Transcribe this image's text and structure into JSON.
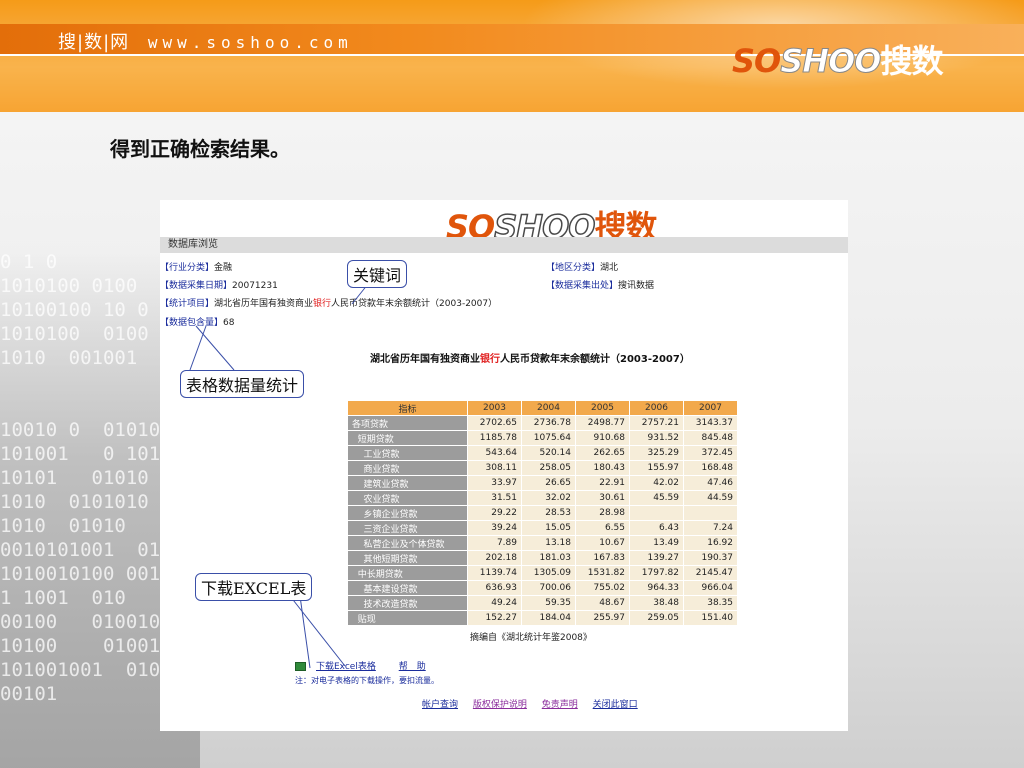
{
  "banner": {
    "site_name": "搜|数|网",
    "site_url": "www.soshoo.com",
    "logo": {
      "so": "SO",
      "shoo": "SHOO",
      "cn": "搜数"
    }
  },
  "heading": "得到正确检索结果。",
  "background_binary": "0 1 0\n1010100 0100\n10100100 10 0\n1010100  0100\n1010  001001\n\n\n10010 0  01010\n101001   0 1010\n10101   01010\n1010  0101010\n1010  01010   0\n0010101001  01\n1010010100 001\n1 1001  010   10\n00100   010010\n10100    01001\n101001001  0100100   010\n00101",
  "panel": {
    "logo": {
      "so": "SO",
      "shoo": "SHOO",
      "cn": "搜数"
    },
    "db_bar": "数据库浏览",
    "industry_label": "【行业分类】",
    "industry_value": "金融",
    "date_label": "【数据采集日期】",
    "date_value": "20071231",
    "stat_label": "【统计项目】",
    "stat_prefix": "湖北省历年国有独资商业",
    "stat_keyword": "银行",
    "stat_suffix": "人民币贷款年末余额统计（2003-2007）",
    "count_label": "【数据包含量】",
    "count_value": "68",
    "region_label": "【地区分类】",
    "region_value": "湖北",
    "source_label": "【数据采集出处】",
    "source_value": "搜讯数据",
    "table_title_prefix": "湖北省历年国有独资商业",
    "table_title_keyword": "银行",
    "table_title_suffix": "人民币贷款年末余额统计（2003-2007）",
    "table": {
      "headers": [
        "指标",
        "2003",
        "2004",
        "2005",
        "2006",
        "2007"
      ],
      "rows": [
        [
          "各项贷款",
          "2702.65",
          "2736.78",
          "2498.77",
          "2757.21",
          "3143.37"
        ],
        [
          "  短期贷款",
          "1185.78",
          "1075.64",
          "910.68",
          "931.52",
          "845.48"
        ],
        [
          "    工业贷款",
          "543.64",
          "520.14",
          "262.65",
          "325.29",
          "372.45"
        ],
        [
          "    商业贷款",
          "308.11",
          "258.05",
          "180.43",
          "155.97",
          "168.48"
        ],
        [
          "    建筑业贷款",
          "33.97",
          "26.65",
          "22.91",
          "42.02",
          "47.46"
        ],
        [
          "    农业贷款",
          "31.51",
          "32.02",
          "30.61",
          "45.59",
          "44.59"
        ],
        [
          "    乡镇企业贷款",
          "29.22",
          "28.53",
          "28.98",
          "",
          ""
        ],
        [
          "    三资企业贷款",
          "39.24",
          "15.05",
          "6.55",
          "6.43",
          "7.24"
        ],
        [
          "    私营企业及个体贷款",
          "7.89",
          "13.18",
          "10.67",
          "13.49",
          "16.92"
        ],
        [
          "    其他短期贷款",
          "202.18",
          "181.03",
          "167.83",
          "139.27",
          "190.37"
        ],
        [
          "  中长期贷款",
          "1139.74",
          "1305.09",
          "1531.82",
          "1797.82",
          "2145.47"
        ],
        [
          "    基本建设贷款",
          "636.93",
          "700.06",
          "755.02",
          "964.33",
          "966.04"
        ],
        [
          "    技术改造贷款",
          "49.24",
          "59.35",
          "48.67",
          "38.48",
          "38.35"
        ],
        [
          "  贴现",
          "152.27",
          "184.04",
          "255.97",
          "259.05",
          "151.40"
        ]
      ]
    },
    "source_note": "摘编自《湖北统计年鉴2008》",
    "download_link": "下载Excel表格",
    "help_link": "帮　助",
    "note": "注：对电子表格的下载操作，要扣流量。",
    "footer_links": [
      "帐户查询",
      "版权保护说明",
      "免责声明",
      "关闭此窗口"
    ]
  },
  "callouts": {
    "keyword": "关键词",
    "table_count": "表格数据量统计",
    "download": "下载EXCEL表"
  },
  "colors": {
    "banner_orange": "#f7a433",
    "table_header": "#f2a94c",
    "table_label_bg": "#9c9c9c",
    "table_cell_bg": "#f6edd9",
    "link_blue": "#1a2c9c",
    "keyword_red": "#e02020",
    "callout_border": "#3a4fa8"
  }
}
